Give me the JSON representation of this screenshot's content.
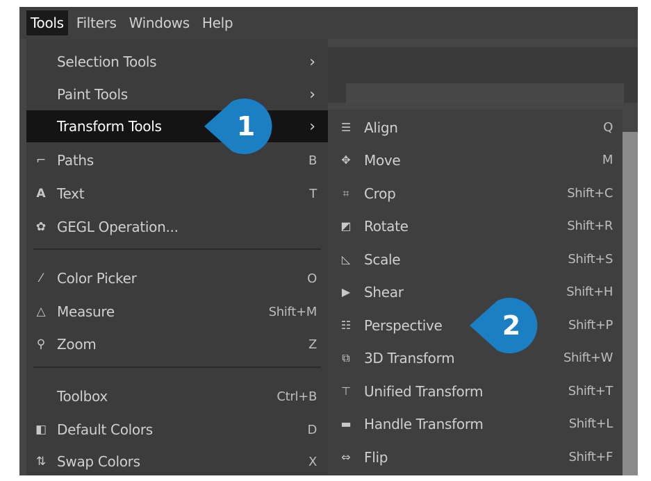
{
  "menubar": {
    "items": [
      "Tools",
      "Filters",
      "Windows",
      "Help"
    ]
  },
  "tools_menu": {
    "items": [
      {
        "label": "Selection Tools",
        "shortcut": "",
        "submenu": true,
        "icon": ""
      },
      {
        "label": "Paint Tools",
        "shortcut": "",
        "submenu": true,
        "icon": ""
      },
      {
        "label": "Transform Tools",
        "shortcut": "",
        "submenu": true,
        "icon": "",
        "highlighted": true
      },
      {
        "label": "Paths",
        "shortcut": "B",
        "submenu": false,
        "icon": "paths-icon"
      },
      {
        "label": "Text",
        "shortcut": "T",
        "submenu": false,
        "icon": "text-icon"
      },
      {
        "label": "GEGL Operation...",
        "shortcut": "",
        "submenu": false,
        "icon": "gegl-icon"
      },
      {
        "label": "Color Picker",
        "shortcut": "O",
        "submenu": false,
        "icon": "color-picker-icon"
      },
      {
        "label": "Measure",
        "shortcut": "Shift+M",
        "submenu": false,
        "icon": "measure-icon"
      },
      {
        "label": "Zoom",
        "shortcut": "Z",
        "submenu": false,
        "icon": "zoom-icon"
      },
      {
        "label": "Toolbox",
        "shortcut": "Ctrl+B",
        "submenu": false,
        "icon": ""
      },
      {
        "label": "Default Colors",
        "shortcut": "D",
        "submenu": false,
        "icon": "default-colors-icon"
      },
      {
        "label": "Swap Colors",
        "shortcut": "X",
        "submenu": false,
        "icon": "swap-colors-icon"
      }
    ]
  },
  "transform_submenu": {
    "items": [
      {
        "label": "Align",
        "shortcut": "Q",
        "icon": "align-icon"
      },
      {
        "label": "Move",
        "shortcut": "M",
        "icon": "move-icon"
      },
      {
        "label": "Crop",
        "shortcut": "Shift+C",
        "icon": "crop-icon"
      },
      {
        "label": "Rotate",
        "shortcut": "Shift+R",
        "icon": "rotate-icon"
      },
      {
        "label": "Scale",
        "shortcut": "Shift+S",
        "icon": "scale-icon"
      },
      {
        "label": "Shear",
        "shortcut": "Shift+H",
        "icon": "shear-icon"
      },
      {
        "label": "Perspective",
        "shortcut": "Shift+P",
        "icon": "perspective-icon"
      },
      {
        "label": "3D Transform",
        "shortcut": "Shift+W",
        "icon": "3d-transform-icon"
      },
      {
        "label": "Unified Transform",
        "shortcut": "Shift+T",
        "icon": "unified-transform-icon"
      },
      {
        "label": "Handle Transform",
        "shortcut": "Shift+L",
        "icon": "handle-transform-icon"
      },
      {
        "label": "Flip",
        "shortcut": "Shift+F",
        "icon": "flip-icon"
      }
    ]
  },
  "callouts": {
    "first": "1",
    "second": "2",
    "color": "#1b7fc4"
  }
}
